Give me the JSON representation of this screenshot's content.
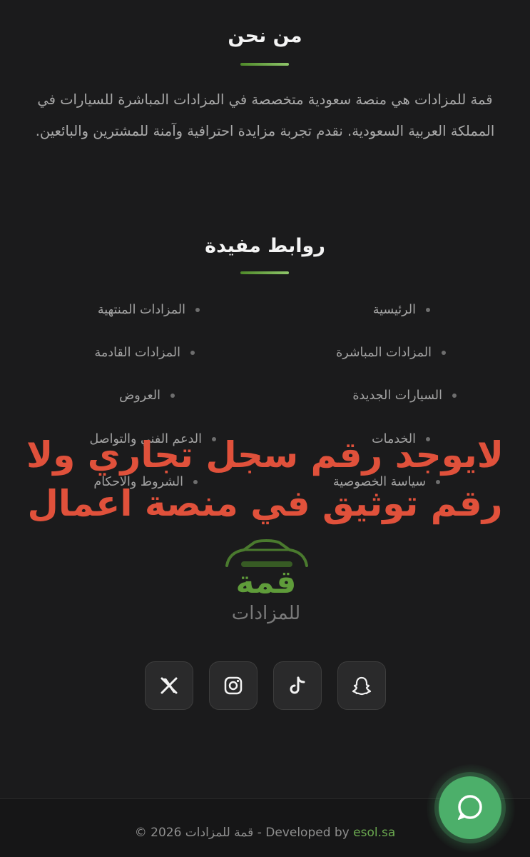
{
  "about": {
    "title": "من نحن",
    "text": "قمة للمزادات هي منصة سعودية متخصصة في المزادات المباشرة للسيارات في المملكة العربية السعودية. نقدم تجربة مزايدة احترافية وآمنة للمشترين والبائعين."
  },
  "links": {
    "title": "روابط مفيدة",
    "right_column": [
      "الرئيسية",
      "المزادات المباشرة",
      "السيارات الجديدة",
      "الخدمات",
      "سياسة الخصوصية"
    ],
    "left_column": [
      "المزادات المنتهية",
      "المزادات القادمة",
      "العروض",
      "الدعم الفني والتواصل",
      "الشروط والاحكام"
    ]
  },
  "overlay": {
    "line1": "لايوجد رقم سجل تجاري ولا",
    "line2": "رقم توثيق في منصة اعمال"
  },
  "logo": {
    "main": "قمة",
    "sub": "للمزادات"
  },
  "social": [
    {
      "name": "snapchat",
      "icon": "snapchat-icon"
    },
    {
      "name": "tiktok",
      "icon": "tiktok-icon"
    },
    {
      "name": "instagram",
      "icon": "instagram-icon"
    },
    {
      "name": "x",
      "icon": "x-icon"
    }
  ],
  "footer": {
    "copyright_prefix": "© 2026 قمة للمزادات - Developed by ",
    "developer": "esol.sa"
  },
  "chat": {
    "icon": "chat-bubble-icon"
  },
  "colors": {
    "background": "#1b1b1c",
    "accent_green": "#6aa84f",
    "overlay_red": "#e0513b",
    "chat_green": "#4caf6a"
  }
}
